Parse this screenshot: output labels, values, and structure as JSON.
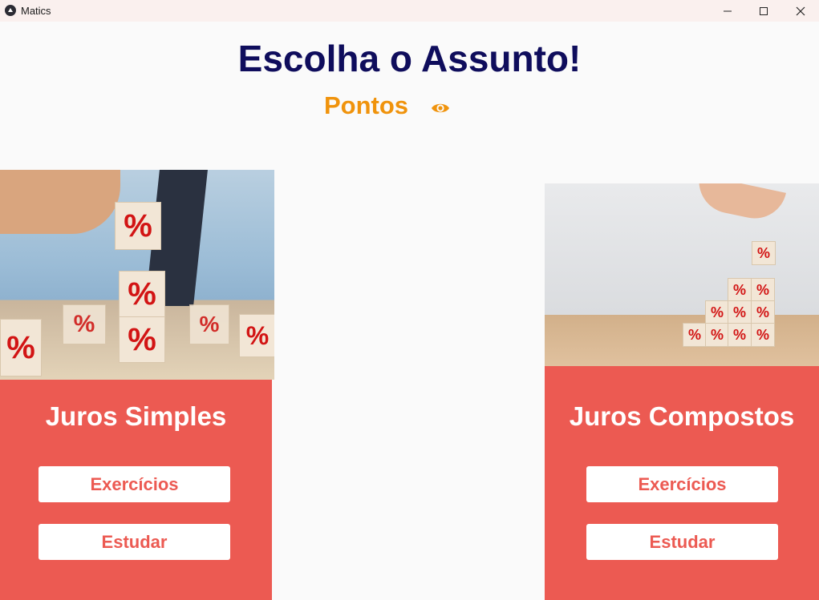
{
  "window": {
    "title": "Matics",
    "controls": [
      "minimize",
      "maximize",
      "close"
    ]
  },
  "header": {
    "title": "Escolha o Assunto!",
    "points_label": "Pontos",
    "points_icon": "eye-icon"
  },
  "cards": [
    {
      "title": "Juros Simples",
      "exercises_label": "Exercícios",
      "study_label": "Estudar",
      "image_glyph": "%"
    },
    {
      "title": "Juros Compostos",
      "exercises_label": "Exercícios",
      "study_label": "Estudar",
      "image_glyph": "%"
    }
  ],
  "colors": {
    "heading": "#0f0d5c",
    "points": "#f0930c",
    "card_panel": "#ec5a52",
    "button_bg": "#ffffff",
    "button_text": "#ec5a52"
  }
}
